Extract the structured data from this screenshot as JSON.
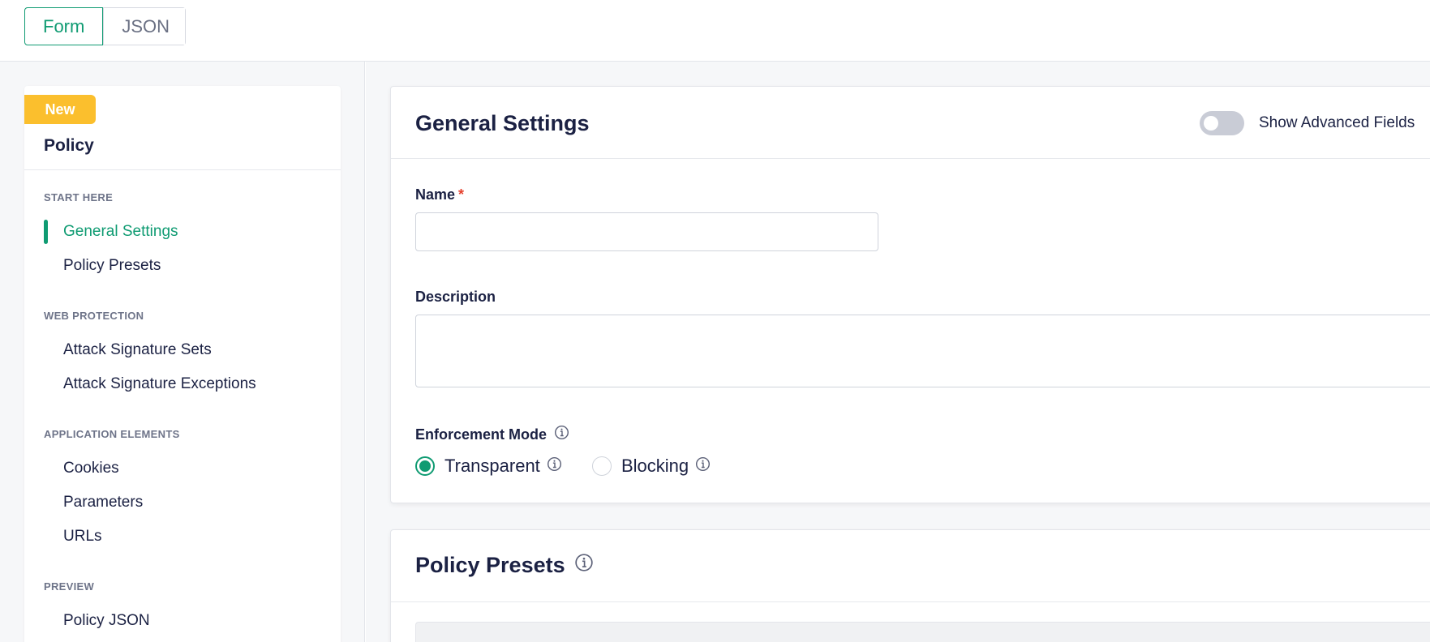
{
  "view_toggle": {
    "form_label": "Form",
    "json_label": "JSON"
  },
  "sidebar": {
    "badge": "New",
    "title": "Policy",
    "sections": [
      {
        "heading": "START HERE",
        "items": [
          "General Settings",
          "Policy Presets"
        ]
      },
      {
        "heading": "WEB PROTECTION",
        "items": [
          "Attack Signature Sets",
          "Attack Signature Exceptions"
        ]
      },
      {
        "heading": "APPLICATION ELEMENTS",
        "items": [
          "Cookies",
          "Parameters",
          "URLs"
        ]
      },
      {
        "heading": "PREVIEW",
        "items": [
          "Policy JSON"
        ]
      }
    ],
    "active_item": "General Settings"
  },
  "general_settings": {
    "title": "General Settings",
    "advanced_toggle_label": "Show Advanced Fields",
    "advanced_toggle_on": false,
    "name_label": "Name",
    "name_required_mark": "*",
    "name_value": "",
    "description_label": "Description",
    "description_value": "",
    "enforcement_label": "Enforcement Mode",
    "enforcement_options": [
      "Transparent",
      "Blocking"
    ],
    "enforcement_selected": "Transparent"
  },
  "policy_presets": {
    "title": "Policy Presets"
  },
  "colors": {
    "accent": "#0f9b72",
    "badge": "#fbbf2d",
    "required": "#e5412d",
    "text": "#1b2143"
  }
}
